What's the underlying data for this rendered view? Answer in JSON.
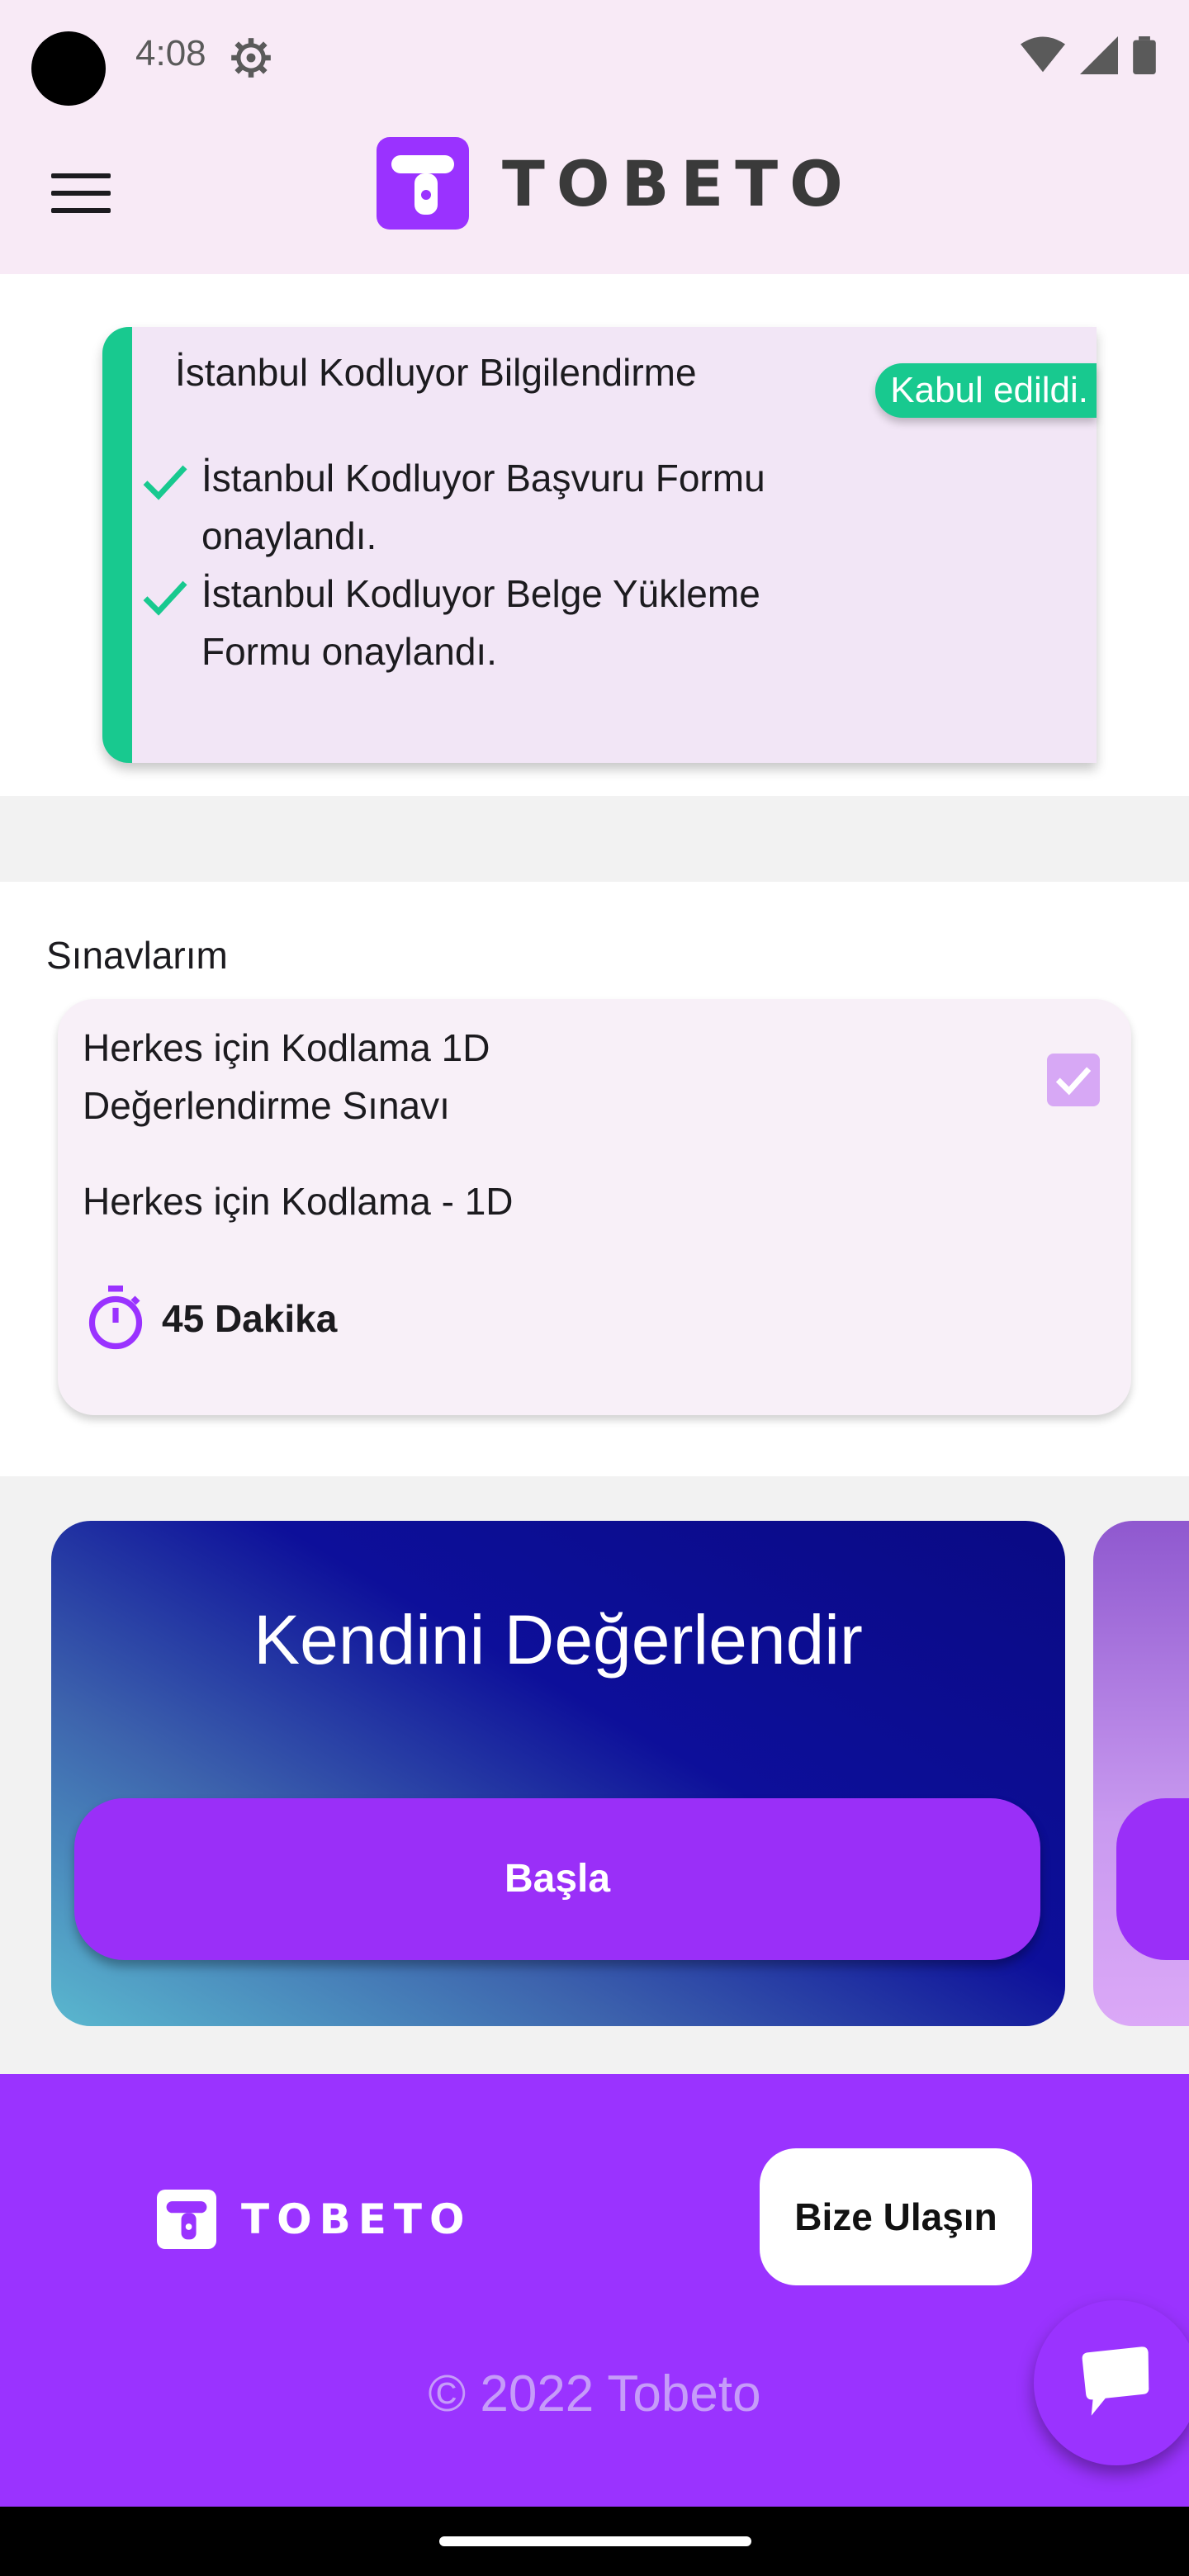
{
  "status_bar": {
    "time": "4:08"
  },
  "app_bar": {
    "logo_text": "TOBETO"
  },
  "notice": {
    "title": "İstanbul Kodluyor Bilgilendirme",
    "badge": "Kabul edildi.",
    "items": [
      {
        "text": "İstanbul Kodluyor Başvuru Formu onaylandı."
      },
      {
        "text": "İstanbul Kodluyor Belge Yükleme Formu onaylandı."
      }
    ],
    "accent_color": "#18c98f"
  },
  "exams": {
    "heading": "Sınavlarım",
    "card": {
      "title": "Herkes için Kodlama 1D Değerlendirme Sınavı",
      "subtitle": "Herkes için Kodlama - 1D",
      "duration": "45 Dakika",
      "completed": true
    }
  },
  "promo": {
    "title": "Kendini Değerlendir",
    "button_label": "Başla"
  },
  "footer": {
    "logo_text": "TOBETO",
    "contact_label": "Bize Ulaşın",
    "copyright": "© 2022 Tobeto",
    "brand_color": "#9a33ff"
  }
}
